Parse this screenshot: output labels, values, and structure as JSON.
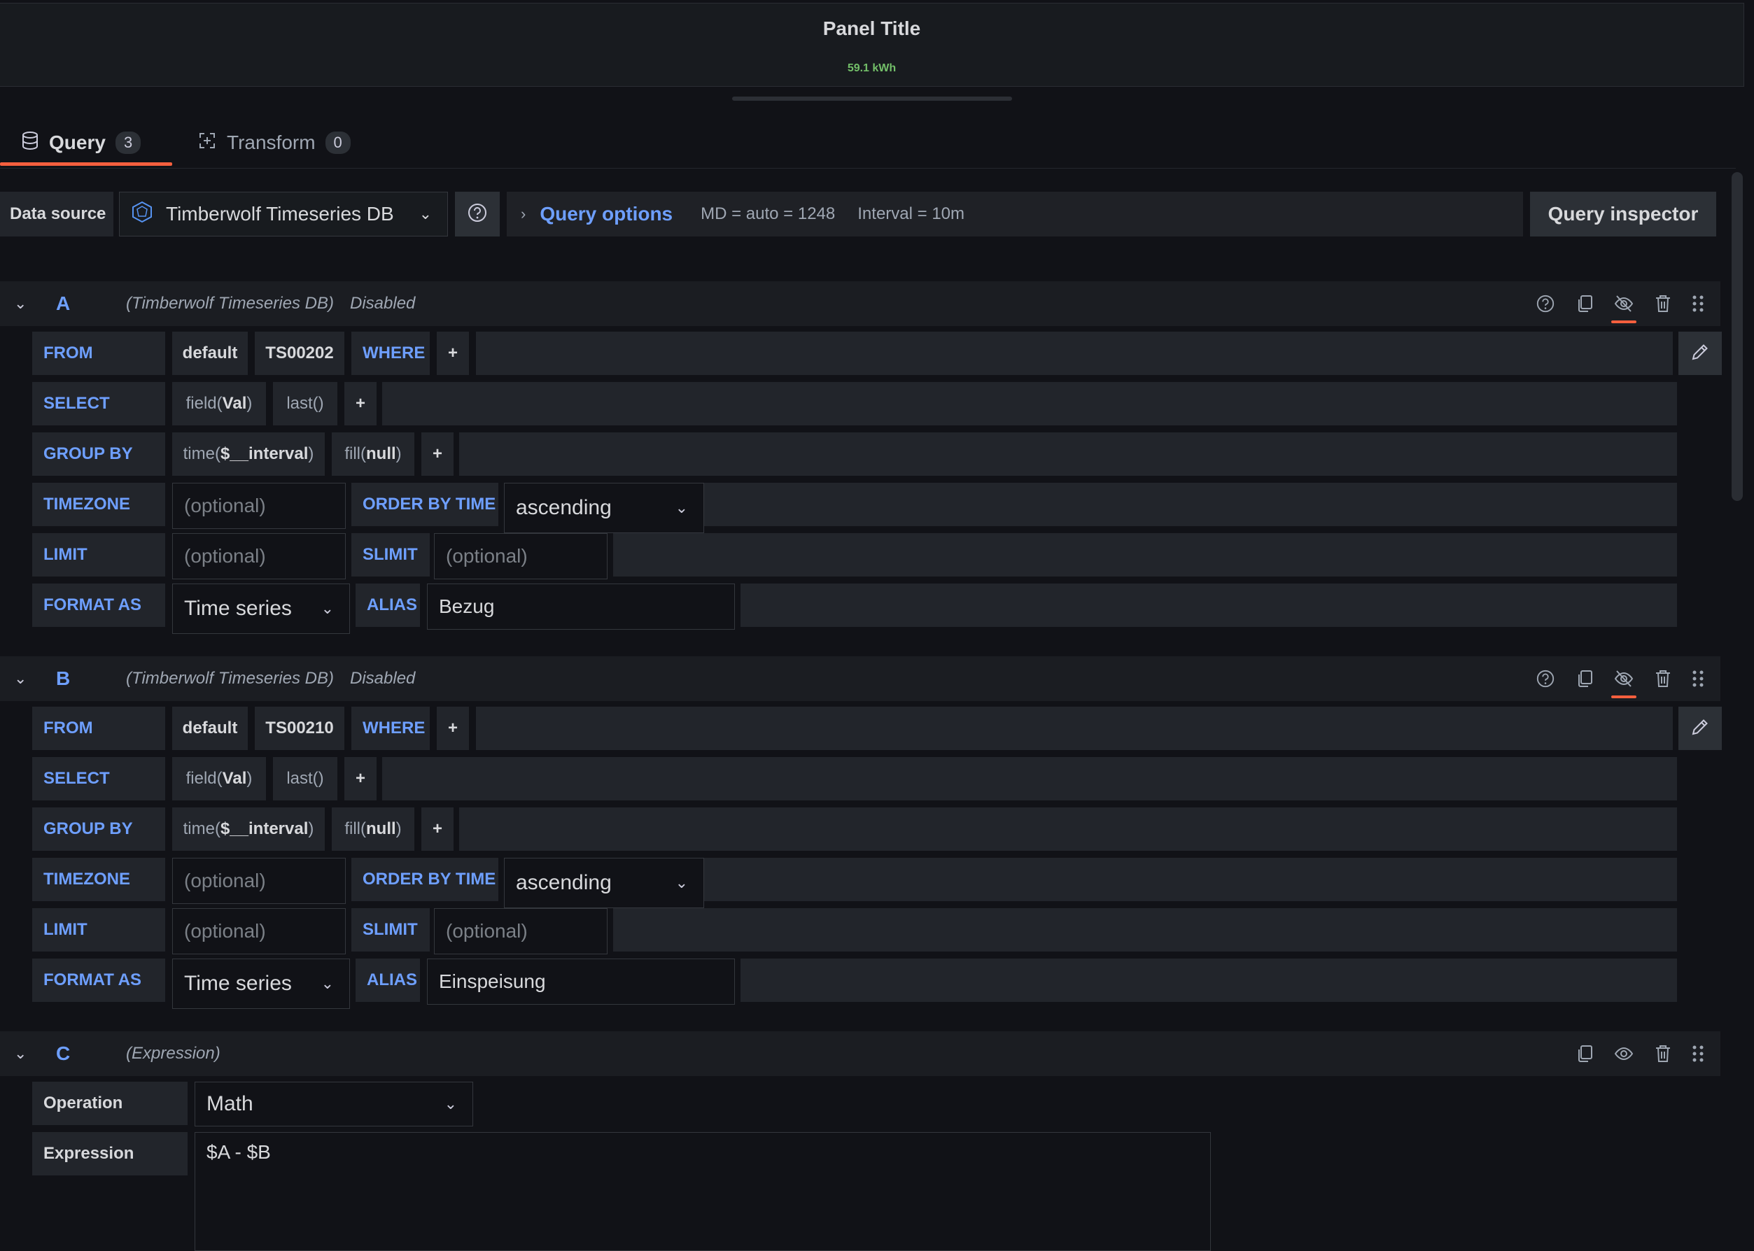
{
  "panel": {
    "title": "Panel Title",
    "value": "59.1 kWh"
  },
  "tabs": [
    {
      "label": "Query",
      "count": "3"
    },
    {
      "label": "Transform",
      "count": "0"
    }
  ],
  "datasource": {
    "label": "Data source",
    "name": "Timberwolf Timeseries DB",
    "query_options_title": "Query options",
    "md_info": "MD = auto = 1248",
    "interval_info": "Interval = 10m",
    "inspector_label": "Query inspector"
  },
  "keywords": {
    "from": "FROM",
    "where": "WHERE",
    "select": "SELECT",
    "group_by": "GROUP BY",
    "timezone": "TIMEZONE",
    "order_by_time": "ORDER BY TIME",
    "limit": "LIMIT",
    "slimit": "SLIMIT",
    "format_as": "FORMAT AS",
    "alias": "ALIAS",
    "plus": "+"
  },
  "builder_parts": {
    "field_fn": "field(",
    "field_arg": "Val",
    "close": ")",
    "last_fn": "last()",
    "time_fn": "time(",
    "time_arg": "$__interval",
    "fill_fn": "fill(",
    "fill_arg": "null",
    "policy": "default",
    "optional_placeholder": "(optional)",
    "order_value": "ascending",
    "format_value": "Time series"
  },
  "queries": {
    "A": {
      "letter": "A",
      "datasource": "(Timberwolf Timeseries DB)",
      "status": "Disabled",
      "measurement": "TS00202",
      "alias": "Bezug"
    },
    "B": {
      "letter": "B",
      "datasource": "(Timberwolf Timeseries DB)",
      "status": "Disabled",
      "measurement": "TS00210",
      "alias": "Einspeisung"
    },
    "C": {
      "letter": "C",
      "datasource": "(Expression)",
      "operation_label": "Operation",
      "operation_value": "Math",
      "expression_label": "Expression",
      "expression_value": "$A - $B"
    }
  },
  "icons": {
    "query_tab": "database-icon",
    "transform_tab": "transform-icon",
    "datasource_logo": "timberwolf-logo-icon",
    "help": "question-circle-icon",
    "duplicate": "copy-icon",
    "hide": "eye-slash-icon",
    "show": "eye-icon",
    "delete": "trash-icon",
    "drag": "drag-handle-icon",
    "edit": "pencil-icon",
    "collapse": "chevron-down-icon",
    "expand": "chevron-right-icon"
  },
  "colors": {
    "accent": "#6e9fff",
    "active_tab": "#f55f3e",
    "value": "#73bf69",
    "background": "#111217"
  }
}
